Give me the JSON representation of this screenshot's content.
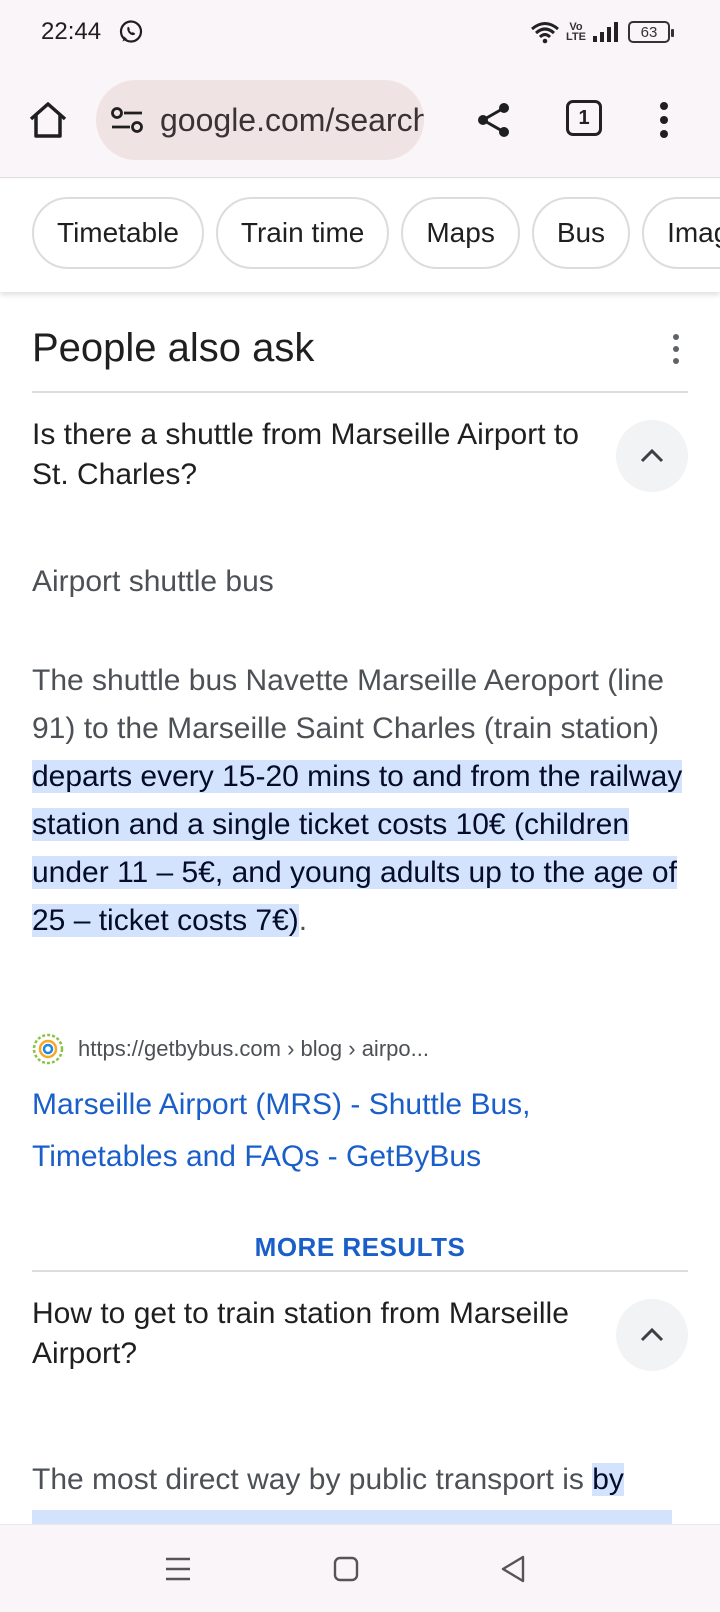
{
  "status_bar": {
    "time": "22:44",
    "battery": "63",
    "network_badge": "Vo LTE",
    "icons": [
      "whatsapp-icon",
      "wifi-icon",
      "signal-icon",
      "battery-icon"
    ]
  },
  "toolbar": {
    "url": "google.com/search",
    "tab_count": "1",
    "icons": [
      "home-icon",
      "site-settings-icon",
      "share-icon",
      "tabs-icon",
      "more-vert-icon"
    ]
  },
  "chips": [
    "Timetable",
    "Train time",
    "Maps",
    "Bus",
    "Images"
  ],
  "paa": {
    "title": "People also ask",
    "q1": {
      "question": "Is there a shuttle from Marseille Airport to St. Charles?",
      "answer_heading": "Airport shuttle bus",
      "answer_plain": "The shuttle bus Navette Marseille Aeroport (line 91) to the Marseille Saint Charles (train station) ",
      "answer_highlight": "departs every 15-20 mins to and from the railway station and a single ticket costs 10€ (children under 11 – 5€, and young adults up to the age of 25 – ticket costs 7€)",
      "answer_end": ".",
      "source_url": "https://getbybus.com › blog › airpo...",
      "source_title": "Marseille Airport (MRS) - Shuttle Bus, Timetables and FAQs - GetByBus"
    },
    "more_results": "MORE RESULTS",
    "q2": {
      "question": "How to get to train station from Marseille Airport?",
      "answer_plain": "The most direct way by public transport is ",
      "answer_highlight": "by"
    }
  },
  "colors": {
    "highlight": "#d3e3fd",
    "link": "#1a5fc9",
    "chrome_bg": "#faf5f9",
    "omnibox_bg": "#efe3e3"
  }
}
